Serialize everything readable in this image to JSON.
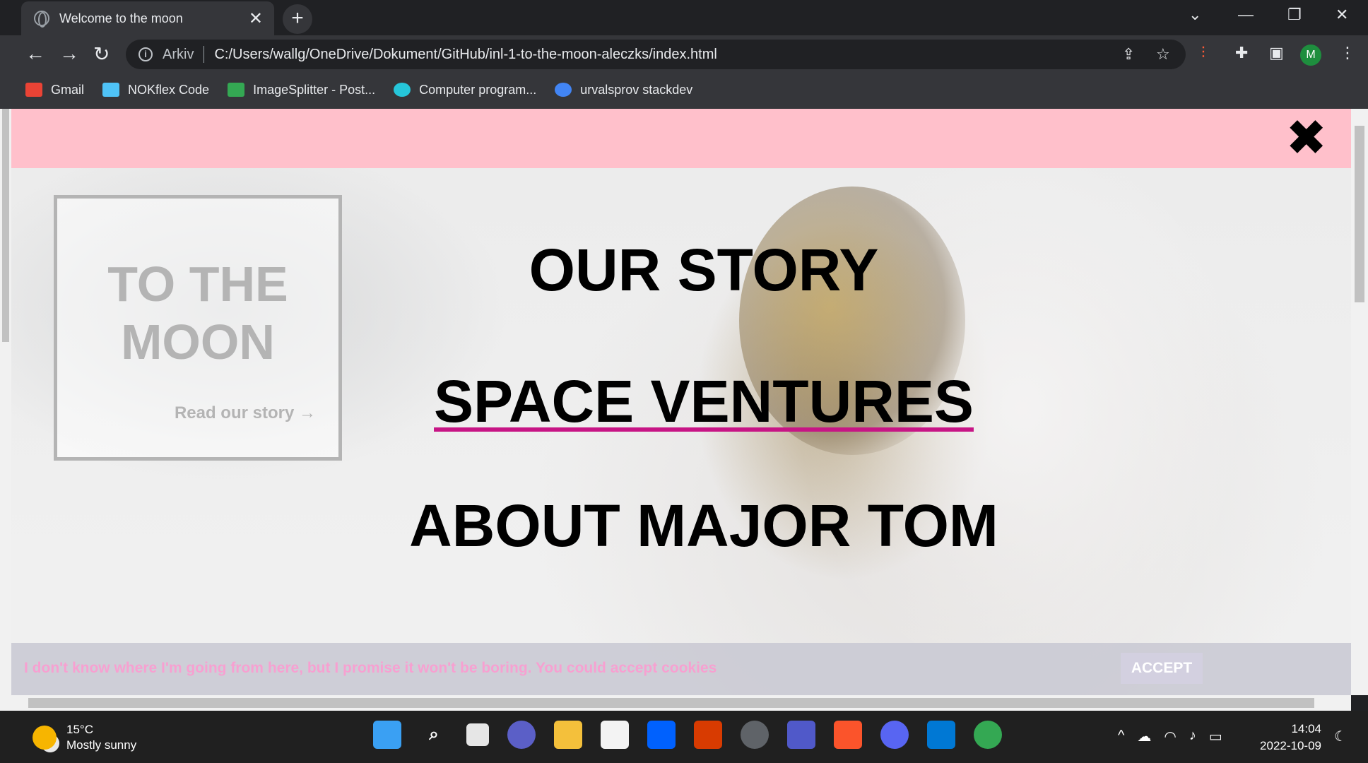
{
  "browser": {
    "tab_title": "Welcome to the moon",
    "tab_close": "✕",
    "new_tab": "+",
    "address_prefix": "Arkiv",
    "address": "C:/Users/wallg/OneDrive/Dokument/GitHub/inl-1-to-the-moon-aleczks/index.html",
    "profile_initial": "M",
    "bookmarks": [
      {
        "label": "Gmail",
        "color": "#ea4335"
      },
      {
        "label": "NOKflex Code",
        "color": "#4fc3f7"
      },
      {
        "label": "ImageSplitter - Post...",
        "color": "#34a853"
      },
      {
        "label": "Computer program...",
        "color": "#26c6da"
      },
      {
        "label": "urvalsprov stackdev",
        "color": "#4285f4"
      }
    ]
  },
  "page": {
    "topbar_color": "#ffc0cb",
    "close_symbol": "✖",
    "logo": {
      "title": "TO THE MOON",
      "link": "Read our story →"
    },
    "menu": [
      {
        "label": "OUR STORY",
        "active": false
      },
      {
        "label": "SPACE VENTURES",
        "active": true
      },
      {
        "label": "ABOUT MAJOR TOM",
        "active": false
      }
    ],
    "cookie": {
      "text": "I don't know where I'm going from here, but I promise it won't be boring. You could accept cookies",
      "accept": "ACCEPT"
    },
    "accent_underline": "#c71585"
  },
  "taskbar": {
    "temperature": "15°C",
    "weather": "Mostly sunny",
    "time": "14:04",
    "date": "2022-10-09",
    "apps": [
      "windows-start",
      "search",
      "task-view",
      "zoom",
      "file-explorer",
      "store",
      "dropbox",
      "office",
      "settings",
      "teams",
      "brave",
      "discord",
      "vscode",
      "chrome"
    ]
  }
}
